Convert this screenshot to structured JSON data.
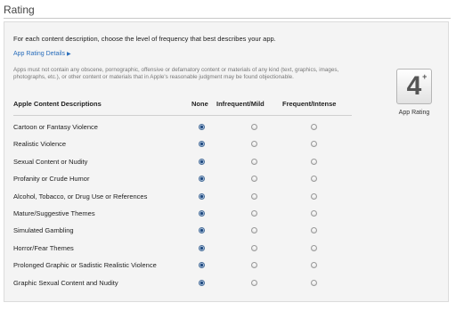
{
  "section": {
    "title": "Rating"
  },
  "panel": {
    "intro": "For each content description, choose the level of frequency that best describes your app.",
    "details_link": "App Rating Details",
    "details_link_arrow": "▶",
    "disclaimer": "Apps must not contain any obscene, pornographic, offensive or defamatory content or materials of any kind (text, graphics, images, photographs, etc.), or other content or materials that in Apple's reasonable judgment may be found objectionable."
  },
  "rating": {
    "value": "4",
    "plus": "+",
    "caption": "App Rating"
  },
  "table": {
    "headers": {
      "description": "Apple Content Descriptions",
      "none": "None",
      "mild": "Infrequent/Mild",
      "intense": "Frequent/Intense"
    },
    "rows": [
      {
        "label": "Cartoon or Fantasy Violence",
        "selected": "none"
      },
      {
        "label": "Realistic Violence",
        "selected": "none"
      },
      {
        "label": "Sexual Content or Nudity",
        "selected": "none"
      },
      {
        "label": "Profanity or Crude Humor",
        "selected": "none"
      },
      {
        "label": "Alcohol, Tobacco, or Drug Use or References",
        "selected": "none"
      },
      {
        "label": "Mature/Suggestive Themes",
        "selected": "none"
      },
      {
        "label": "Simulated Gambling",
        "selected": "none"
      },
      {
        "label": "Horror/Fear Themes",
        "selected": "none"
      },
      {
        "label": "Prolonged Graphic or Sadistic Realistic Violence",
        "selected": "none"
      },
      {
        "label": "Graphic Sexual Content and Nudity",
        "selected": "none"
      }
    ]
  },
  "colors": {
    "link": "#2a6ebb",
    "radio_checked": "#1f4a80",
    "panel_bg": "#f4f4f4"
  }
}
